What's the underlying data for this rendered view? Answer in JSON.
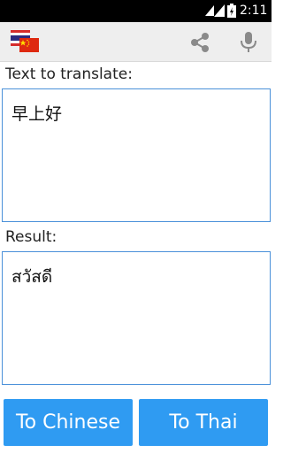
{
  "status_bar": {
    "time": "2:11",
    "icons": [
      "wifi-icon",
      "signal-icon",
      "battery-icon"
    ]
  },
  "action_bar": {
    "icons": [
      "thai-chinese-flag-icon",
      "share-icon",
      "microphone-icon"
    ]
  },
  "source": {
    "label": "Text to translate:",
    "value": "早上好"
  },
  "result": {
    "label": "Result:",
    "value": "สวัสดี"
  },
  "buttons": {
    "to_chinese": "To Chinese",
    "to_thai": "To Thai"
  },
  "colors": {
    "accent": "#2f9bf2",
    "field_border": "#4a90d9",
    "action_bar": "#eeeeee",
    "status_bar": "#000000"
  }
}
